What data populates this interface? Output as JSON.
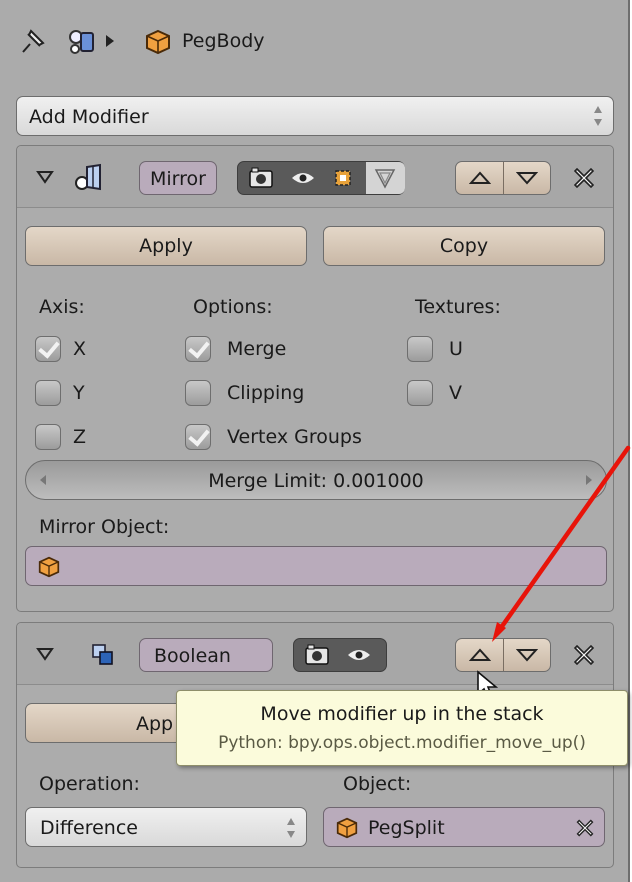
{
  "header": {
    "object_name": "PegBody",
    "icons": [
      "pin-icon",
      "object-data-icon",
      "triangle-right-icon",
      "cube-icon"
    ]
  },
  "add_modifier": {
    "label": "Add Modifier"
  },
  "mirror": {
    "name": "Mirror",
    "apply_label": "Apply",
    "copy_label": "Copy",
    "axis_heading": "Axis:",
    "options_heading": "Options:",
    "textures_heading": "Textures:",
    "axis": [
      {
        "label": "X",
        "checked": true
      },
      {
        "label": "Y",
        "checked": false
      },
      {
        "label": "Z",
        "checked": false
      }
    ],
    "options": [
      {
        "label": "Merge",
        "checked": true
      },
      {
        "label": "Clipping",
        "checked": false
      },
      {
        "label": "Vertex Groups",
        "checked": true
      }
    ],
    "textures": [
      {
        "label": "U",
        "checked": false
      },
      {
        "label": "V",
        "checked": false
      }
    ],
    "merge_limit": "Merge Limit: 0.001000",
    "mirror_object_label": "Mirror Object:",
    "mirror_object_value": ""
  },
  "boolean": {
    "name": "Boolean",
    "apply_label": "App",
    "operation_label": "Operation:",
    "operation_value": "Difference",
    "object_label": "Object:",
    "object_value": "PegSplit"
  },
  "tooltip": {
    "title": "Move modifier up in the stack",
    "python": "Python: bpy.ops.object.modifier_move_up()"
  },
  "colors": {
    "panel_bg": "#ababab",
    "button_tan": "#d6c7b6",
    "field_purple": "#b9abbb",
    "tooltip_bg": "#fbfbdb",
    "annotation_arrow": "#e8140a"
  }
}
